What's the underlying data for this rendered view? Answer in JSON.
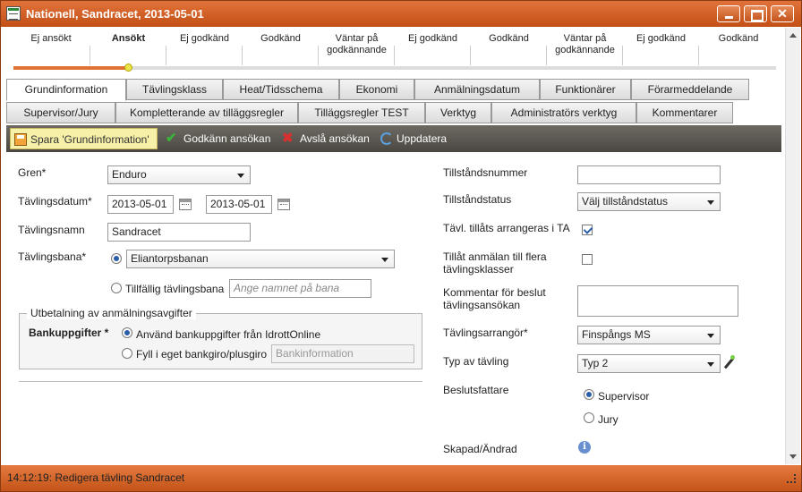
{
  "window": {
    "title": "Nationell, Sandracet, 2013-05-01"
  },
  "steps": [
    {
      "label": "Ej ansökt",
      "bold": false
    },
    {
      "label": "Ansökt",
      "bold": true
    },
    {
      "label": "Ej godkänd",
      "bold": false
    },
    {
      "label": "Godkänd",
      "bold": false
    },
    {
      "label": "Väntar på godkännande",
      "bold": false
    },
    {
      "label": "Ej godkänd",
      "bold": false
    },
    {
      "label": "Godkänd",
      "bold": false
    },
    {
      "label": "Väntar på godkännande",
      "bold": false
    },
    {
      "label": "Ej godkänd",
      "bold": false
    },
    {
      "label": "Godkänd",
      "bold": false
    }
  ],
  "tabs_row1": [
    "Grundinformation",
    "Tävlingsklass",
    "Heat/Tidsschema",
    "Ekonomi",
    "Anmälningsdatum",
    "Funktionärer",
    "Förarmeddelande"
  ],
  "tabs_row2": [
    "Supervisor/Jury",
    "Kompletterande av tilläggsregler",
    "Tilläggsregler TEST",
    "Verktyg",
    "Administratörs verktyg",
    "Kommentarer"
  ],
  "active_tab": "Grundinformation",
  "toolbar": {
    "save": "Spara 'Grundinformation'",
    "approve": "Godkänn ansökan",
    "reject": "Avslå ansökan",
    "refresh": "Uppdatera"
  },
  "form_left": {
    "gren_label": "Gren*",
    "gren_value": "Enduro",
    "datum_label": "Tävlingsdatum*",
    "datum_from": "2013-05-01",
    "datum_to": "2013-05-01",
    "namn_label": "Tävlingsnamn",
    "namn_value": "Sandracet",
    "bana_label": "Tävlingsbana*",
    "bana_value": "Eliantorpsbanan",
    "tillfallig_label": "Tillfällig tävlingsbana",
    "tillfallig_placeholder": "Ange namnet på bana",
    "group_title": "Utbetalning av anmälningsavgifter",
    "bankupp_label": "Bankuppgifter *",
    "bank_opt1": "Använd bankuppgifter från IdrottOnline",
    "bank_opt2": "Fyll i eget bankgiro/plusgiro",
    "bank_placeholder": "Bankinformation"
  },
  "form_right": {
    "tillstandsnummer_label": "Tillståndsnummer",
    "tillstandsnummer_value": "",
    "tillstandstatus_label": "Tillståndstatus",
    "tillstandstatus_value": "Välj tillståndstatus",
    "ta_label": "Tävl. tillåts arrangeras i TA",
    "flera_label": "Tillåt anmälan till flera tävlingsklasser",
    "kommentar_label": "Kommentar för beslut tävlingsansökan",
    "arrangor_label": "Tävlingsarrangör*",
    "arrangor_value": "Finspångs MS",
    "typ_label": "Typ av tävling",
    "typ_value": "Typ 2",
    "beslut_label": "Beslutsfattare",
    "beslut_opt1": "Supervisor",
    "beslut_opt2": "Jury",
    "skapad_label": "Skapad/Ändrad"
  },
  "status": {
    "text": "14:12:19: Redigera tävling Sandracet"
  }
}
